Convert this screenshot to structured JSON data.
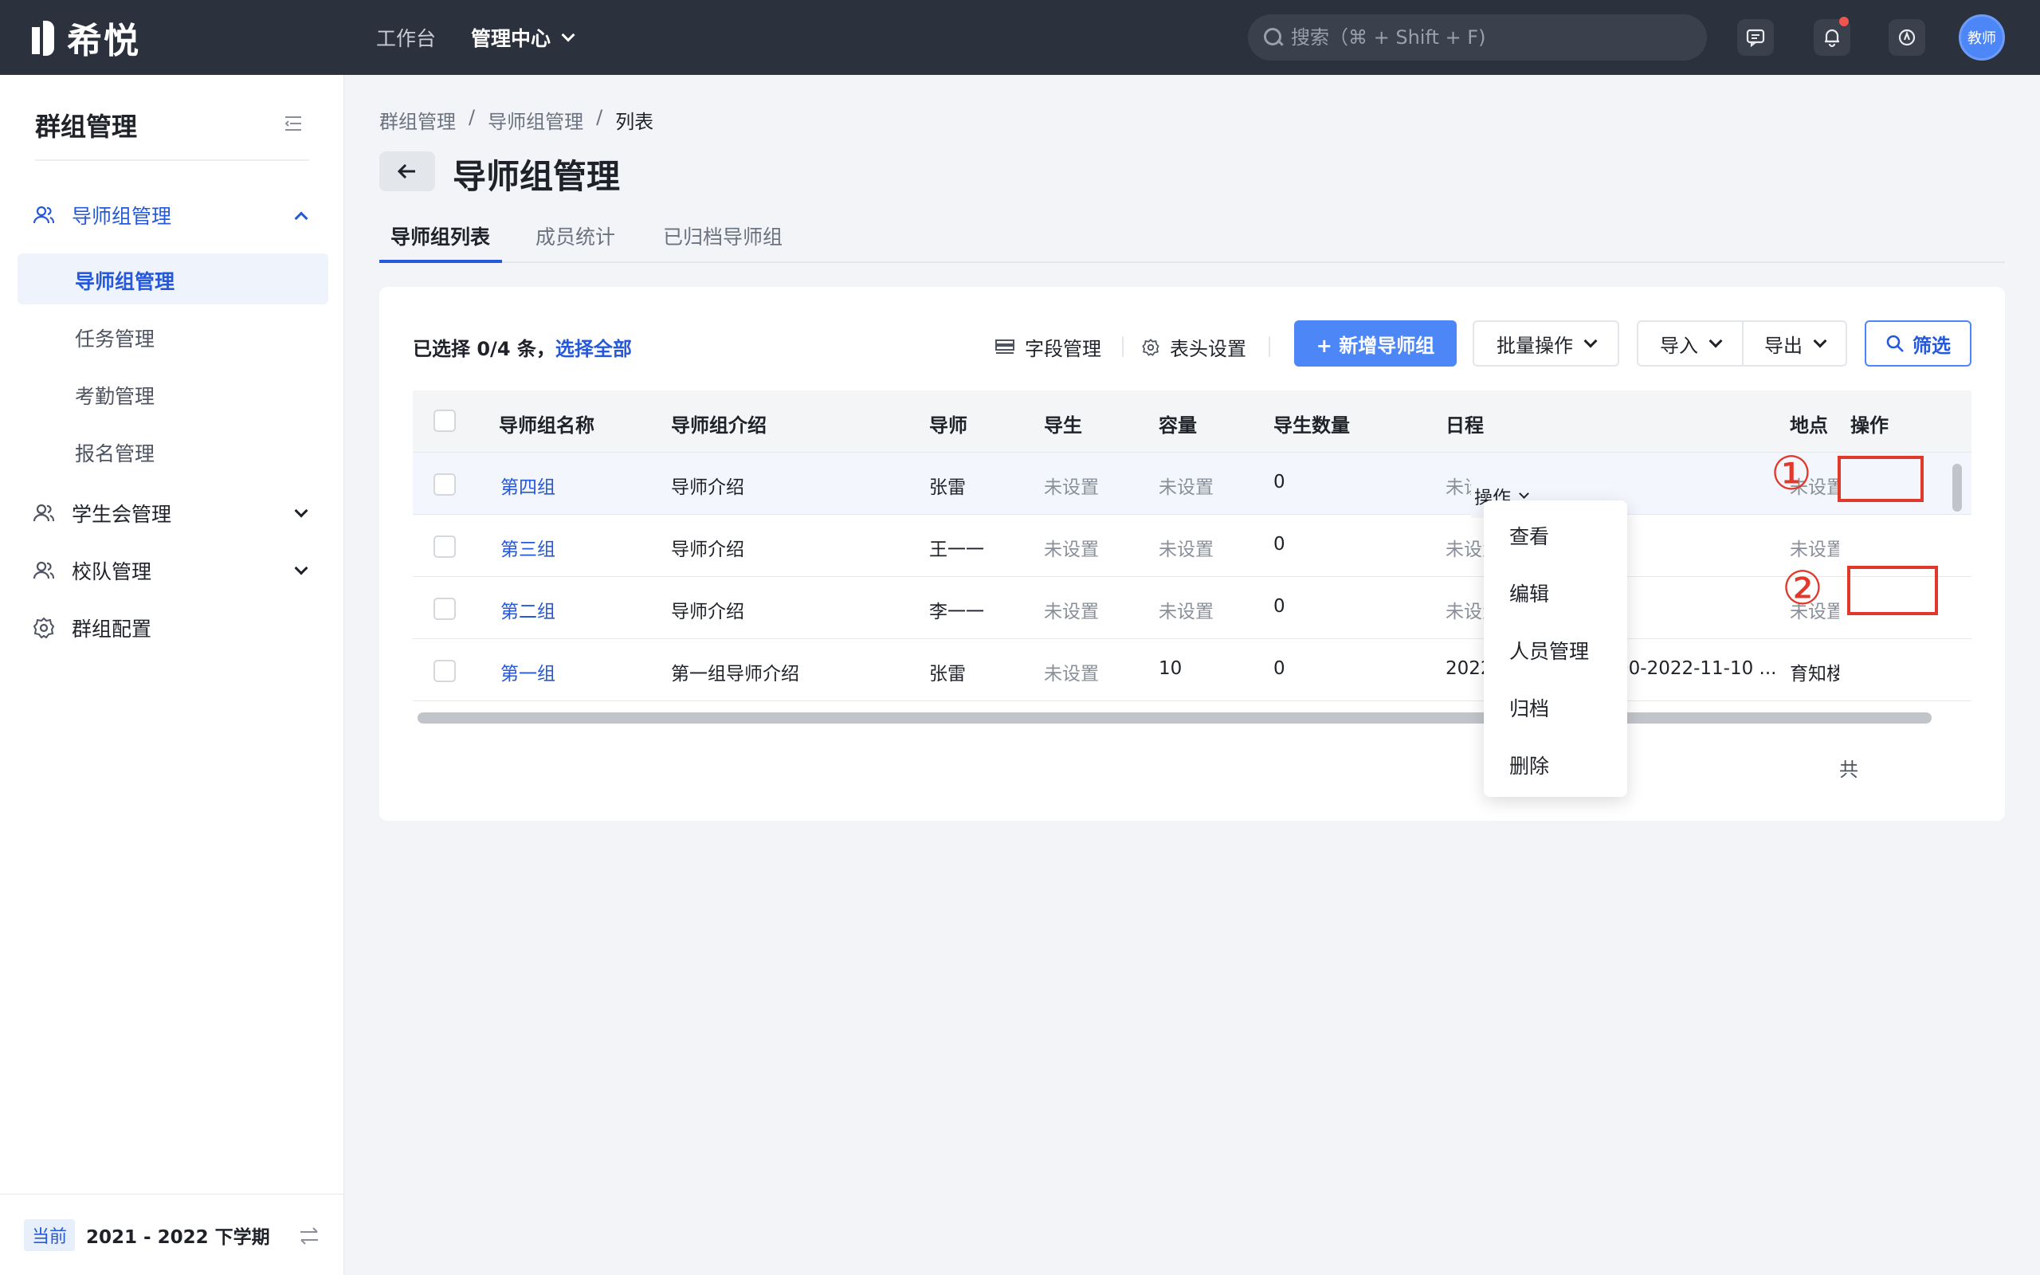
{
  "topbar": {
    "logo_text": "希悦",
    "nav": [
      {
        "label": "工作台"
      },
      {
        "label": "管理中心"
      }
    ],
    "search_placeholder": "搜索（⌘ + Shift + F)",
    "avatar_label": "教师"
  },
  "sidebar": {
    "title": "群组管理",
    "groups": [
      {
        "label": "导师组管理"
      },
      {
        "label": "学生会管理"
      },
      {
        "label": "校队管理"
      },
      {
        "label": "群组配置"
      }
    ],
    "subitems": [
      {
        "label": "导师组管理"
      },
      {
        "label": "任务管理"
      },
      {
        "label": "考勤管理"
      },
      {
        "label": "报名管理"
      }
    ],
    "footer": {
      "badge": "当前",
      "term": "2021 - 2022 下学期"
    }
  },
  "breadcrumb": [
    "群组管理",
    "/",
    "导师组管理",
    "/",
    "列表"
  ],
  "page_title": "导师组管理",
  "tabs": [
    {
      "label": "导师组列表"
    },
    {
      "label": "成员统计"
    },
    {
      "label": "已归档导师组"
    }
  ],
  "toolbar": {
    "selected": "已选择 0/4 条，",
    "select_all": "选择全部",
    "field_manage": "字段管理",
    "header_settings": "表头设置",
    "add_group": "+ 新增导师组",
    "batch": "批量操作",
    "import": "导入",
    "export": "导出",
    "filter": "筛选"
  },
  "table": {
    "columns": [
      "导师组名称",
      "导师组介绍",
      "导师",
      "导生",
      "容量",
      "导生数量",
      "日程",
      "地点",
      "操作"
    ],
    "rows": [
      {
        "name": "第四组",
        "intro": "导师介绍",
        "tutor": "张雷",
        "students": "未设置",
        "capacity": "未设置",
        "count": "0",
        "schedule": "未设置",
        "location": "未设置"
      },
      {
        "name": "第三组",
        "intro": "导师介绍",
        "tutor": "王一一",
        "students": "未设置",
        "capacity": "未设置",
        "count": "0",
        "schedule": "未设置",
        "location": "未设置"
      },
      {
        "name": "第二组",
        "intro": "导师介绍",
        "tutor": "李一一",
        "students": "未设置",
        "capacity": "未设置",
        "count": "0",
        "schedule": "未设置",
        "location": "未设置"
      },
      {
        "name": "第一组",
        "intro": "第一组导师介绍",
        "tutor": "张雷",
        "students": "未设置",
        "capacity": "10",
        "count": "0",
        "schedule": "2022-11-10 17:00:00-2022-11-10 ...",
        "location": "育知楼"
      }
    ],
    "action_label": "操作",
    "total_fragment": "共"
  },
  "dropdown": {
    "items": [
      "查看",
      "编辑",
      "人员管理",
      "归档",
      "删除"
    ]
  },
  "annotations": {
    "step1": "①",
    "step2": "②"
  },
  "colors": {
    "accent": "#2659d9",
    "primary_button": "#4d87f7",
    "highlight": "#e0392b",
    "topbar": "#2b313d"
  }
}
